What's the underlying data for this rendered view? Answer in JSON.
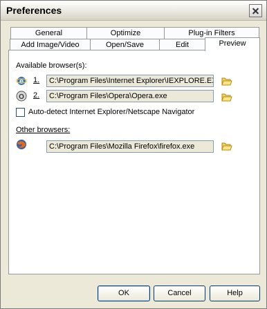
{
  "window": {
    "title": "Preferences"
  },
  "tabs": {
    "row1": [
      "General",
      "Optimize",
      "Plug-in Filters"
    ],
    "row2": [
      "Add Image/Video",
      "Open/Save",
      "Edit",
      "Preview"
    ],
    "active": "Preview"
  },
  "preview": {
    "available_label": "Available browser(s):",
    "browsers": [
      {
        "index": "1.",
        "path": "C:\\Program Files\\Internet Explorer\\IEXPLORE.EX"
      },
      {
        "index": "2.",
        "path": "C:\\Program Files\\Opera\\Opera.exe"
      }
    ],
    "autodetect_label": "Auto-detect Internet Explorer/Netscape Navigator",
    "other_label": "Other browsers:",
    "other_path": "C:\\Program Files\\Mozilla Firefox\\firefox.exe"
  },
  "buttons": {
    "ok": "OK",
    "cancel": "Cancel",
    "help": "Help"
  }
}
